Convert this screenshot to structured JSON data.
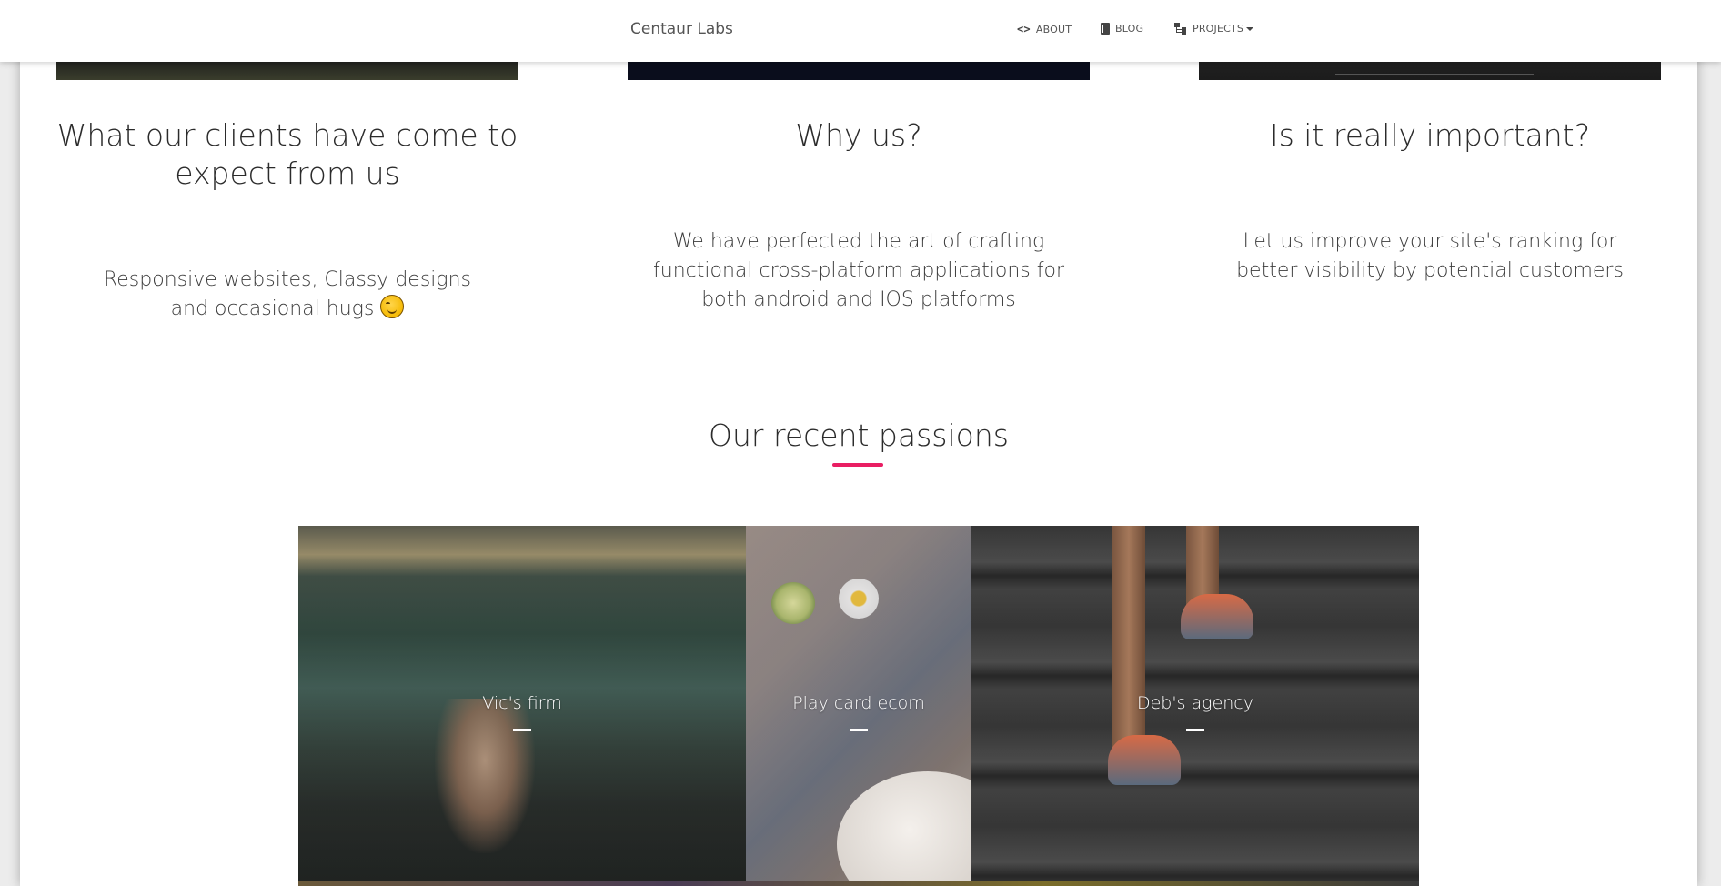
{
  "navbar": {
    "brand": "Centaur Labs",
    "items": [
      {
        "label": "ABOUT",
        "icon": "code-icon"
      },
      {
        "label": "BLOG",
        "icon": "book-icon"
      },
      {
        "label": "PROJECTS",
        "icon": "sitemap-icon",
        "dropdown": true
      }
    ]
  },
  "features": [
    {
      "title": "What our clients have come to expect from us",
      "text": "Responsive websites, Classy designs and occasional hugs",
      "emoji": "yum-face-emoji"
    },
    {
      "title": "Why us?",
      "text": "We have perfected the art of crafting functional cross-platform applications for both android and IOS platforms"
    },
    {
      "title": "Is it really important?",
      "text": "Let us improve your site's ranking for better visibility by potential customers"
    }
  ],
  "portfolio": {
    "title": "Our recent passions",
    "accent_color": "#e91e63",
    "items": [
      {
        "label": "Vic's firm"
      },
      {
        "label": "Play card ecom"
      },
      {
        "label": "Deb's agency"
      }
    ]
  }
}
